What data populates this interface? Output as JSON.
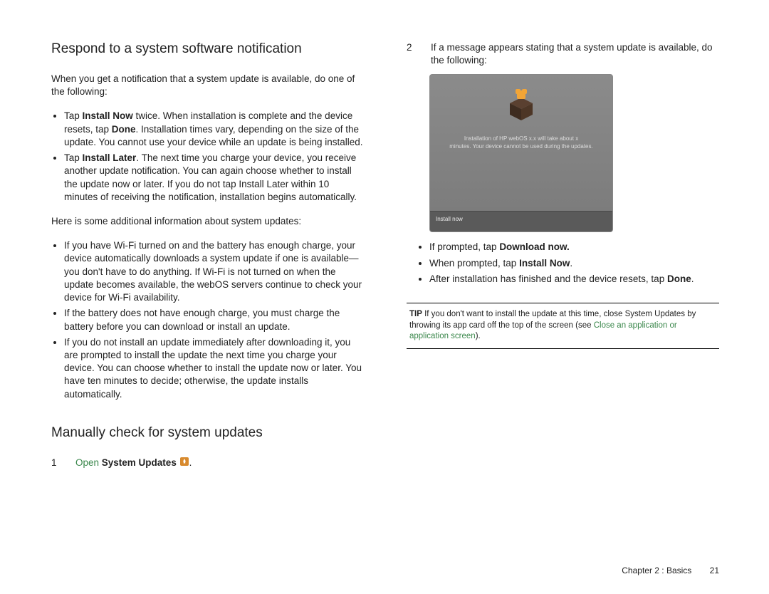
{
  "left": {
    "heading1": "Respond to a system software notification",
    "intro": "When you get a notification that a system update is available, do one of the following:",
    "bullet1": {
      "prefix": "Tap ",
      "bold1": "Install Now",
      "mid": " twice. When installation is complete and the device resets, tap ",
      "bold2": "Done",
      "suffix": ". Installation times vary, depending on the size of the update. You cannot use your device while an update is being installed."
    },
    "bullet2": {
      "prefix": "Tap ",
      "bold1": "Install Later",
      "suffix": ". The next time you charge your device, you receive another update notification. You can again choose whether to install the update now or later. If you do not tap Install Later within 10 minutes of receiving the notification, installation begins automatically."
    },
    "addl_intro": "Here is some additional information about system updates:",
    "addl_b1": "If you have Wi-Fi turned on and the battery has enough charge, your device automatically downloads a system update if one is available—you don't have to do anything. If Wi-Fi is not turned on when the update becomes available, the webOS servers continue to check your device for Wi-Fi availability.",
    "addl_b2": "If the battery does not have enough charge, you must charge the battery before you can download or install an update.",
    "addl_b3": "If you do not install an update immediately after downloading it, you are prompted to install the update the next time you charge your device. You can choose whether to install the update now or later. You have ten minutes to decide; otherwise, the update installs automatically.",
    "heading2": "Manually check for system updates",
    "step1": {
      "num": "1",
      "open": "Open ",
      "bold": "System Updates ",
      "dot": "."
    }
  },
  "right": {
    "step2": {
      "num": "2",
      "text": "If a message appears stating that a system update is available, do the following:"
    },
    "shot_msg_l1": "Installation of HP webOS x.x will take about x",
    "shot_msg_l2": "minutes. Your device cannot be used during the updates.",
    "shot_button": "Install now",
    "sb1": {
      "pre": "If prompted, tap ",
      "bold": "Download now."
    },
    "sb2": {
      "pre": "When prompted, tap ",
      "bold": "Install Now",
      "post": "."
    },
    "sb3": {
      "pre": "After installation has finished and the device resets, tap ",
      "bold": "Done",
      "post": "."
    },
    "tip": {
      "label": "TIP",
      "text": "  If you don't want to install the update at this time, close System Updates by throwing its app card off the top of the screen (see ",
      "link": "Close an application or application screen",
      "after": ")."
    }
  },
  "footer": {
    "chapter": "Chapter 2 : Basics",
    "page": "21"
  }
}
